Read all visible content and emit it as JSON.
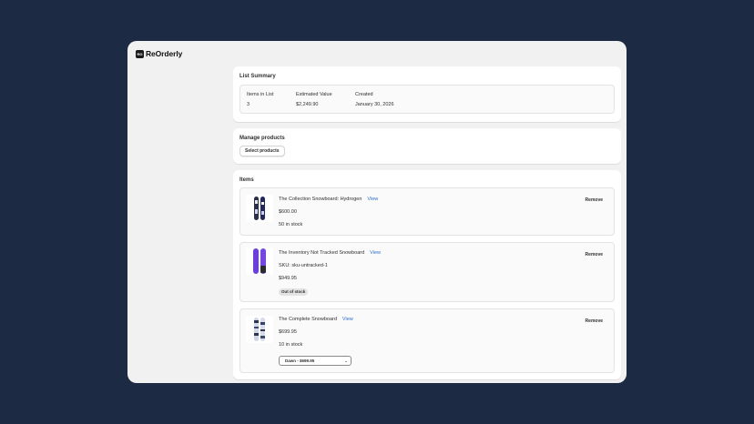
{
  "app": {
    "name": "ReOrderly",
    "logo_text": "RO"
  },
  "summary": {
    "title": "List Summary",
    "items_label": "Items in List",
    "items_value": "3",
    "value_label": "Estimated Value",
    "value_value": "$2,249.90",
    "created_label": "Created",
    "created_value": "January 30, 2026"
  },
  "manage": {
    "title": "Manage products",
    "select_label": "Select products"
  },
  "items": {
    "title": "Items",
    "list": [
      {
        "name": "The Collection Snowboard: Hydrogen",
        "view": "View",
        "price": "$600.00",
        "stock": "50 in stock",
        "remove": "Remove"
      },
      {
        "name": "The Inventory Not Tracked Snowboard",
        "view": "View",
        "sku": "SKU: sku-untracked-1",
        "price": "$949.95",
        "badge": "Out of stock",
        "remove": "Remove"
      },
      {
        "name": "The Complete Snowboard",
        "view": "View",
        "price": "$699.95",
        "stock": "10 in stock",
        "variant": "Dawn - $699.95",
        "remove": "Remove"
      }
    ]
  }
}
